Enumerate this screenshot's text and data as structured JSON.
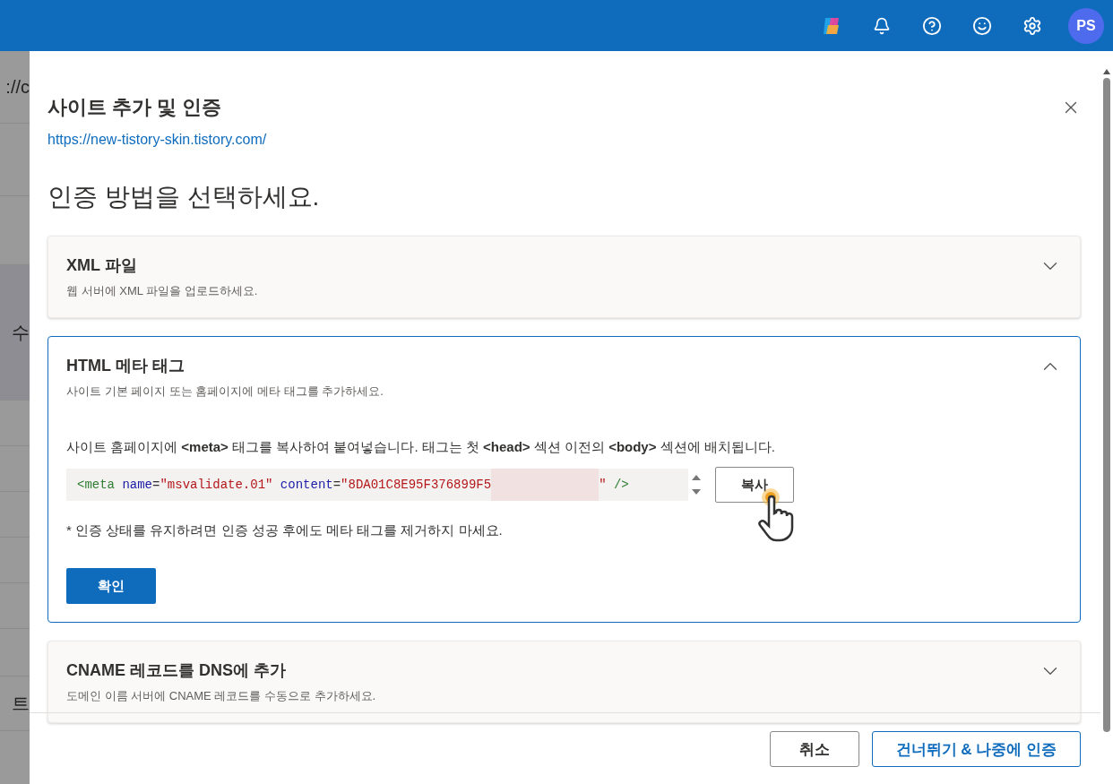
{
  "top_bar": {
    "icons": [
      {
        "kind": "copilot"
      },
      {
        "kind": "bell"
      },
      {
        "kind": "help"
      },
      {
        "kind": "smiley"
      },
      {
        "kind": "settings"
      }
    ],
    "avatar": "PS"
  },
  "background": {
    "fragments": [
      "://c",
      "수",
      "트"
    ]
  },
  "dialog": {
    "title": "사이트 추가 및 인증",
    "url": "https://new-tistory-skin.tistory.com/",
    "heading": "인증 방법을 선택하세요.",
    "options": [
      {
        "title": "XML 파일",
        "description": "웹 서버에 XML 파일을 업로드하세요.",
        "expanded": false
      },
      {
        "title": "HTML 메타 태그",
        "description": "사이트 기본 페이지 또는 홈페이지에 메타 태그를 추가하세요.",
        "expanded": true,
        "instruction": "사이트 홈페이지에 **<meta>** 태그를 복사하여 붙여넣습니다. 태그는 첫 **<head>** 섹션 이전의 **<body>** 섹션에 배치됩니다.",
        "code": [
          {
            "kind": "tag",
            "text": "<meta"
          },
          {
            "kind": "attr",
            "text": " name"
          },
          {
            "kind": "punct",
            "text": "="
          },
          {
            "kind": "string",
            "text": "\"msvalidate.01\""
          },
          {
            "kind": "attr",
            "text": " content"
          },
          {
            "kind": "punct",
            "text": "="
          },
          {
            "kind": "string",
            "text": "\"8DA01C8E95F376899F5"
          },
          {
            "kind": "redacted"
          },
          {
            "kind": "string",
            "text": "\""
          },
          {
            "kind": "tag",
            "text": " />"
          }
        ],
        "copy_button": "복사",
        "note": "* 인증 상태를 유지하려면 인증 성공 후에도 메타 태그를 제거하지 마세요.",
        "confirm_button": "확인"
      },
      {
        "title": "CNAME 레코드를 DNS에 추가",
        "description": "도메인 이름 서버에 CNAME 레코드를 수동으로 추가하세요.",
        "expanded": false
      }
    ],
    "footer": {
      "cancel": "취소",
      "skip": "건너뛰기 & 나중에 인증"
    }
  }
}
